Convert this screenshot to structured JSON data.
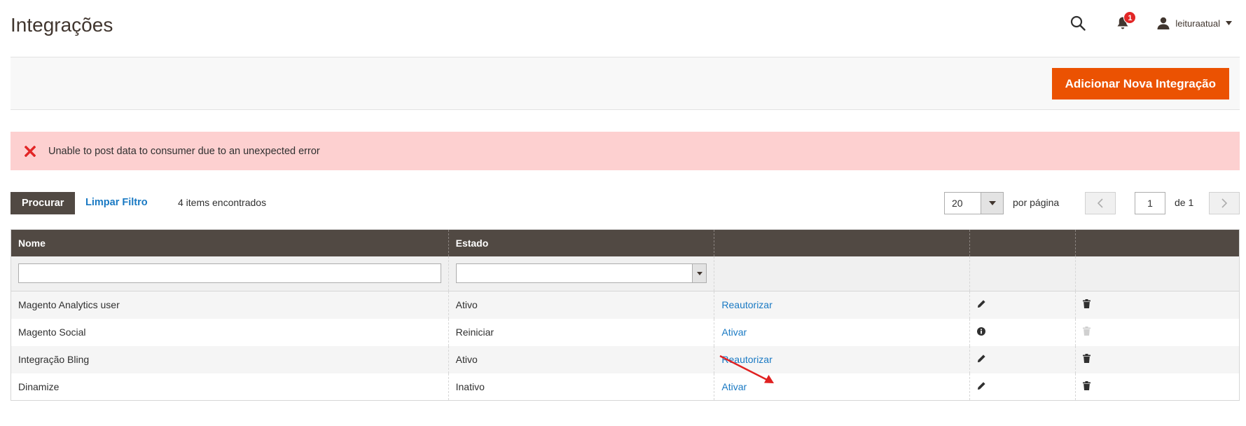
{
  "page": {
    "title": "Integrações"
  },
  "header": {
    "search_icon": "search-icon",
    "notifications": {
      "icon": "bell-icon",
      "count": "1"
    },
    "user": {
      "icon": "user-icon",
      "name": "leituraatual"
    }
  },
  "actions": {
    "add_label": "Adicionar Nova Integração"
  },
  "message": {
    "type": "error",
    "icon": "close-x-icon",
    "text": "Unable to post data to consumer due to an unexpected error"
  },
  "toolbar": {
    "search_label": "Procurar",
    "reset_label": "Limpar Filtro",
    "records": "4 items encontrados",
    "page_size": "20",
    "per_page_label": "por página",
    "current_page": "1",
    "of_label": "de 1"
  },
  "grid": {
    "columns": [
      "Nome",
      "Estado",
      "",
      "",
      ""
    ],
    "rows": [
      {
        "name": "Magento Analytics user",
        "status": "Ativo",
        "action": "Reautorizar",
        "edit_icon": "pencil-icon",
        "delete_icon": "trash-icon",
        "delete_disabled": false
      },
      {
        "name": "Magento Social",
        "status": "Reiniciar",
        "action": "Ativar",
        "edit_icon": "info-icon",
        "delete_icon": "trash-icon",
        "delete_disabled": true
      },
      {
        "name": "Integração Bling",
        "status": "Ativo",
        "action": "Reautorizar",
        "edit_icon": "pencil-icon",
        "delete_icon": "trash-icon",
        "delete_disabled": false
      },
      {
        "name": "Dinamize",
        "status": "Inativo",
        "action": "Ativar",
        "edit_icon": "pencil-icon",
        "delete_icon": "trash-icon",
        "delete_disabled": false
      }
    ]
  },
  "colors": {
    "accent": "#eb5202",
    "header_bg": "#514943",
    "link": "#1979c3",
    "error_bg": "#fdd0d0",
    "error_icon": "#e22626",
    "annotation": "#e02020"
  }
}
